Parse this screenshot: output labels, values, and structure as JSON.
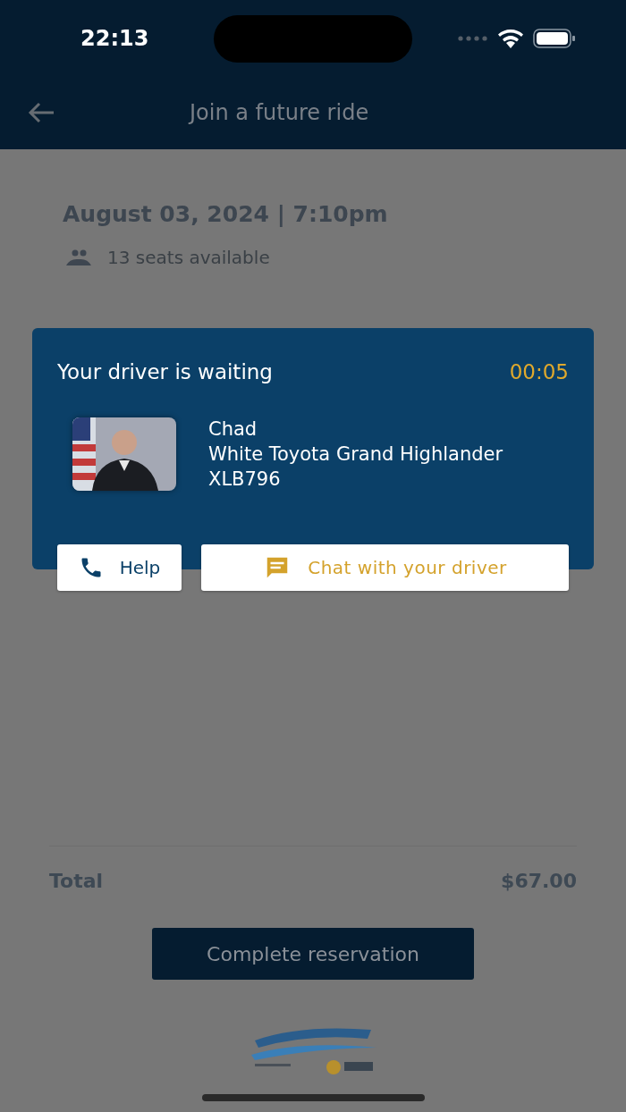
{
  "status_bar": {
    "time": "22:13"
  },
  "nav": {
    "title": "Join a future ride"
  },
  "ride": {
    "date": "August 03, 2024 | 7:10pm",
    "seats": "13 seats available"
  },
  "summary": {
    "label": "Total",
    "amount": "$67.00"
  },
  "primary_button": "Complete reservation",
  "dialog": {
    "title": "Your driver is waiting",
    "timer": "00:05",
    "driver": {
      "name": "Chad",
      "vehicle": "White Toyota Grand Highlander",
      "plate": "XLB796"
    },
    "buttons": [
      {
        "kind": "call",
        "label": "Help"
      },
      {
        "kind": "chat",
        "label": "Chat with your driver"
      }
    ]
  }
}
